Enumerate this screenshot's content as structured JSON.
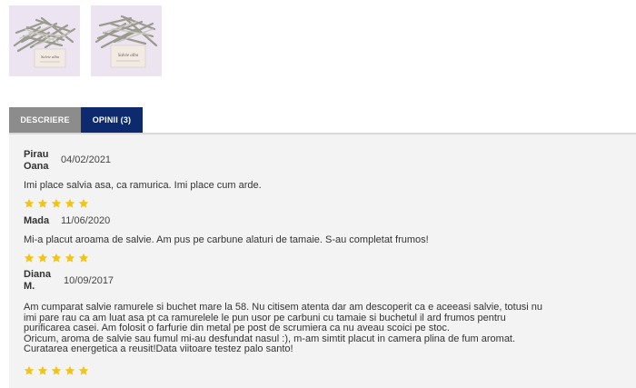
{
  "gallery": {
    "thumbnails": [
      {
        "label": "Salvie alba",
        "icon": "white-sage-photo"
      },
      {
        "label": "Salvie alba",
        "icon": "white-sage-photo"
      }
    ]
  },
  "tabs": [
    {
      "label": "DESCRIERE",
      "active": false
    },
    {
      "label": "OPINII (3)",
      "active": true
    }
  ],
  "colors": {
    "active_tab": "#0e2a6e",
    "inactive_tab": "#8c8c8c",
    "star": "#f0c419",
    "panel": "#f3f3f3"
  },
  "reviews": [
    {
      "author_line1": "Pirau",
      "author_line2": "Oana",
      "date": "04/02/2021",
      "text": "Imi place salvia asa, ca ramurica. Imi place cum arde.",
      "rating": 5
    },
    {
      "author_line1": "Mada",
      "author_line2": "",
      "date": "11/06/2020",
      "text": "Mi-a placut aroama de salvie. Am pus pe carbune alaturi de tamaie. S-au completat frumos!",
      "rating": 5
    },
    {
      "author_line1": "Diana",
      "author_line2": "M.",
      "date": "10/09/2017",
      "text_lines": [
        "Am cumparat salvie ramurele si buchet mare la 58. Nu citisem atenta dar am descoperit ca e aceeasi salvie, totusi nu",
        "imi pare rau ca am luat asa pt ca ramurelele le pun usor pe carbuni cu tamaie si buchetul il ard frumos pentru",
        "purificarea casei. Am folosit o farfurie din metal pe post de scrumiera ca nu aveau scoici pe stoc.",
        "Oricum, aroma de salvie sau fumul mi-au desfundat nasul :), m-am simtit placut in camera plina de fum aromat.",
        "Curatarea energetica a reusit!Data viitoare testez palo santo!"
      ],
      "rating": 5
    }
  ]
}
